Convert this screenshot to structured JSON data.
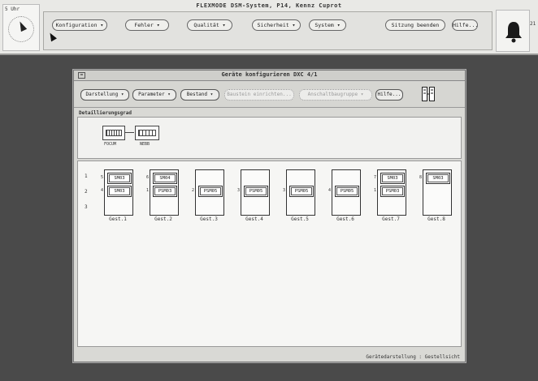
{
  "app": {
    "title": "FLEXMODE DSM-System, P14, Kennz Cuprot",
    "clock_label": "5 Uhr",
    "bell_count": "21"
  },
  "menu": [
    {
      "label": "Konfiguration ▾"
    },
    {
      "label": "Fehler ▾"
    },
    {
      "label": "Qualität ▾"
    },
    {
      "label": "Sicherheit ▾"
    },
    {
      "label": "System ▾"
    },
    {
      "label": "Sitzung beenden"
    },
    {
      "label": "Hilfe..."
    }
  ],
  "window": {
    "menu_icon": "=",
    "title": "Geräte konfigurieren DXC 4/1",
    "toolbar": [
      {
        "label": "Darstellung ▾",
        "disabled": false
      },
      {
        "label": "Parameter ▾",
        "disabled": false
      },
      {
        "label": "Bestand ▾",
        "disabled": false
      },
      {
        "label": "Baustein einrichten...",
        "disabled": true
      },
      {
        "label": "Anschaltbaugruppe ▾",
        "disabled": true
      },
      {
        "label": "Hilfe...",
        "disabled": false
      }
    ],
    "detail_label": "Detaillierungsgrad",
    "overview": {
      "left_label": "FOCUM",
      "right_label": "NEBB"
    },
    "rows": [
      "1",
      "2",
      "3"
    ],
    "cabinets": [
      {
        "label": "Gest.1",
        "modules": [
          {
            "slot": "5",
            "text": "SM03"
          },
          {
            "slot": "4",
            "text": "SM03"
          }
        ]
      },
      {
        "label": "Gest.2",
        "modules": [
          {
            "slot": "6",
            "text": "SM04"
          },
          {
            "slot": "1",
            "text": "PSM03"
          }
        ]
      },
      {
        "label": "Gest.3",
        "modules": [
          {
            "slot": "",
            "text": ""
          },
          {
            "slot": "2",
            "text": "PSM05"
          }
        ]
      },
      {
        "label": "Gest.4",
        "modules": [
          {
            "slot": "",
            "text": ""
          },
          {
            "slot": "3",
            "text": "PSM05"
          }
        ]
      },
      {
        "label": "Gest.5",
        "modules": [
          {
            "slot": "",
            "text": ""
          },
          {
            "slot": "3",
            "text": "PSM05"
          }
        ]
      },
      {
        "label": "Gest.6",
        "modules": [
          {
            "slot": "",
            "text": ""
          },
          {
            "slot": "4",
            "text": "PSM05"
          }
        ]
      },
      {
        "label": "Gest.7",
        "modules": [
          {
            "slot": "7",
            "text": "SM03"
          },
          {
            "slot": "1",
            "text": "PSM03"
          }
        ]
      },
      {
        "label": "Gest.8",
        "modules": [
          {
            "slot": "8",
            "text": "SM03"
          },
          {
            "slot": "",
            "text": ""
          }
        ]
      }
    ],
    "status": "Gerätedarstellung : Gestellsicht"
  }
}
